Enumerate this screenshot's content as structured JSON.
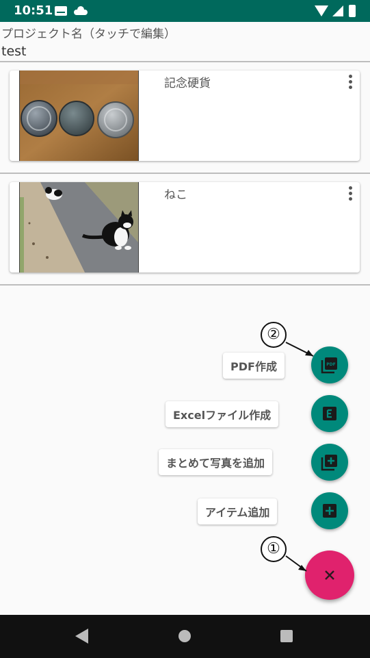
{
  "status_bar": {
    "time": "10:51",
    "icons": [
      "gmail-icon",
      "cloud-icon",
      "wifi-icon",
      "signal-icon",
      "battery-icon"
    ]
  },
  "project": {
    "label": "プロジェクト名（タッチで編集）",
    "name": "test"
  },
  "items": [
    {
      "title": "記念硬貨",
      "image": "coins-photo",
      "menu_icon": "more-vert-icon"
    },
    {
      "title": "ねこ",
      "image": "cat-photo",
      "menu_icon": "more-vert-icon"
    }
  ],
  "speed_dial": {
    "actions": [
      {
        "label": "PDF作成",
        "icon": "pdf-icon"
      },
      {
        "label": "Excelファイル作成",
        "icon": "excel-icon"
      },
      {
        "label": "まとめて写真を追加",
        "icon": "add-photos-icon"
      },
      {
        "label": "アイテム追加",
        "icon": "add-box-icon"
      }
    ],
    "main_icon": "close-icon"
  },
  "callouts": [
    "②",
    "①"
  ],
  "colors": {
    "status_bar": "#00695c",
    "fab_mini": "#00897b",
    "fab_main": "#e0226d",
    "nav_bar": "#111111"
  },
  "nav_bar": {
    "icons": [
      "back-icon",
      "home-icon",
      "recents-icon"
    ]
  }
}
